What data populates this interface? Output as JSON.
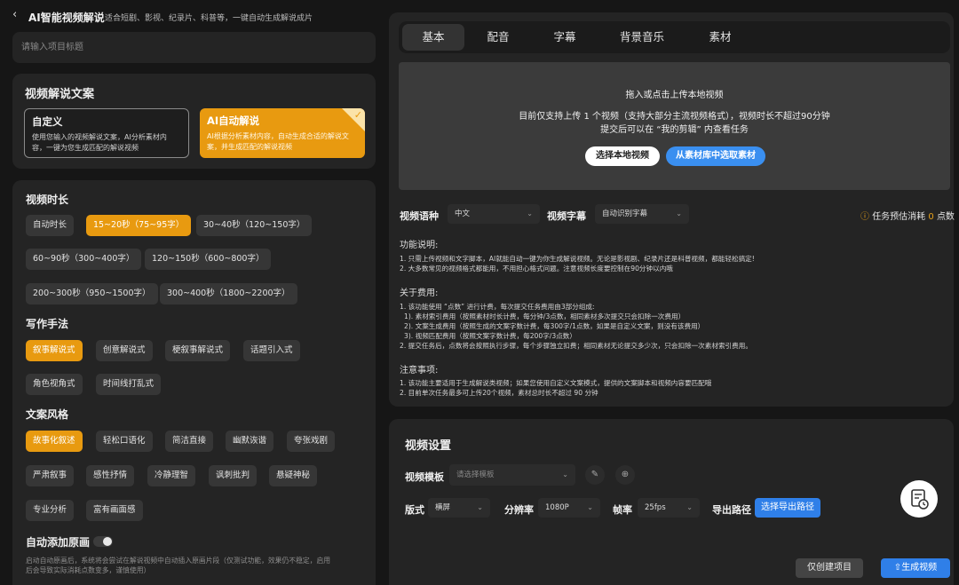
{
  "header": {
    "back_icon": "chevron-left-icon",
    "title": "AI智能视频解说",
    "subtitle": "适合短剧、影视、纪录片、科普等，一键自动生成解说成片"
  },
  "project": {
    "title_placeholder": "请输入项目标题"
  },
  "script_section": {
    "title": "视频解说文案",
    "cards": [
      {
        "title": "自定义",
        "desc1": "使用您输入的视频解说文案，AI分析素材内",
        "desc2": "容，一键为您生成匹配的解说视频",
        "selected": false
      },
      {
        "title": "AI自动解说",
        "desc1": "AI根据分析素材内容，自动生成合适的解说文",
        "desc2": "案，并生成匹配的解说视频",
        "selected": true
      }
    ]
  },
  "duration": {
    "title": "视频时长",
    "options": [
      "自动时长",
      "15~20秒（75~95字）",
      "30~40秒（120~150字）",
      "60~90秒（300~400字）",
      "120~150秒（600~800字）",
      "200~300秒（950~1500字）",
      "300~400秒（1800~2200字）"
    ],
    "selected": 1
  },
  "writing": {
    "title": "写作手法",
    "options": [
      "叙事解说式",
      "创意解说式",
      "梗叙事解说式",
      "话题引入式",
      "角色视角式",
      "时间线打乱式"
    ],
    "selected": 0
  },
  "style": {
    "title": "文案风格",
    "options": [
      "故事化叙述",
      "轻松口语化",
      "简洁直接",
      "幽默诙谐",
      "夸张戏剧",
      "严肃叙事",
      "感性抒情",
      "冷静理智",
      "讽刺批判",
      "悬疑神秘",
      "专业分析",
      "富有画面感"
    ],
    "selected": 0
  },
  "auto_clip": {
    "title": "自动添加原画",
    "enabled": false,
    "desc1": "启动自动原画后，系统将会尝试在解说视频中自动插入原画片段（仅测试功能，效果仍不稳定，启用",
    "desc2": "后会导致实际消耗点数变多，谨慎使用）"
  },
  "tabs": [
    "基本",
    "配音",
    "字幕",
    "背景音乐",
    "素材"
  ],
  "upload": {
    "line1": "拖入或点击上传本地视频",
    "line2": "目前仅支持上传 1 个视频（支持大部分主流视频格式），视频时长不超过90分钟",
    "line3": "提交后可以在 “我的剪辑” 内查看任务",
    "btn_local": "选择本地视频",
    "btn_library": "从素材库中选取素材"
  },
  "lang": {
    "label": "视频语种",
    "value": "中文",
    "sub_label": "视频字幕",
    "sub_value": "自动识别字幕",
    "cost_prefix": "任务预估消耗",
    "cost_value": "0",
    "cost_suffix": "点数"
  },
  "notes": {
    "h1": "功能说明:",
    "f1": "1. 只需上传视频和文字脚本，AI就能自动一键为你生成解说视频。无论是影视剧、纪录片还是科普视频，都能轻松搞定!",
    "f2": "2. 大多数常见的视频格式都能用，不用担心格式问题。注意视频长度要控制在90分钟以内哦",
    "h2": "关于费用:",
    "c1": "1. 该功能使用 “点数” 进行计费，每次提交任务费用由3部分组成:",
    "c2": "1). 素材索引费用（按照素材时长计费，每分钟/3点数，相同素材多次提交只会扣除一次费用）",
    "c3": "2). 文案生成费用（按照生成的文案字数计费，每300字/1点数，如果是自定义文案，则没有该费用）",
    "c4": "3). 视频匹配费用（按照文案字数计费，每200字/3点数）",
    "c5": "2. 提交任务后，点数将会按照执行步骤，每个步骤独立扣费；相同素材无论提交多少次，只会扣除一次素材索引费用。",
    "h3": "注意事项:",
    "n1": "1. 该功能主要适用于生成解说类视频；如果您使用自定义文案模式，提供的文案脚本和视频内容要匹配哦",
    "n2": "2. 目前单次任务最多可上传20个视频，素材总时长不超过 90 分钟"
  },
  "video_settings": {
    "title": "视频设置",
    "template_label": "视频模板",
    "template_placeholder": "请选择模板",
    "layout_label": "版式",
    "layout_value": "横屏",
    "res_label": "分辨率",
    "res_value": "1080P",
    "fps_label": "帧率",
    "fps_value": "25fps",
    "export_label": "导出路径",
    "export_btn": "选择导出路径"
  },
  "footer": {
    "create_only": "仅创建项目",
    "generate": "生成视频"
  }
}
